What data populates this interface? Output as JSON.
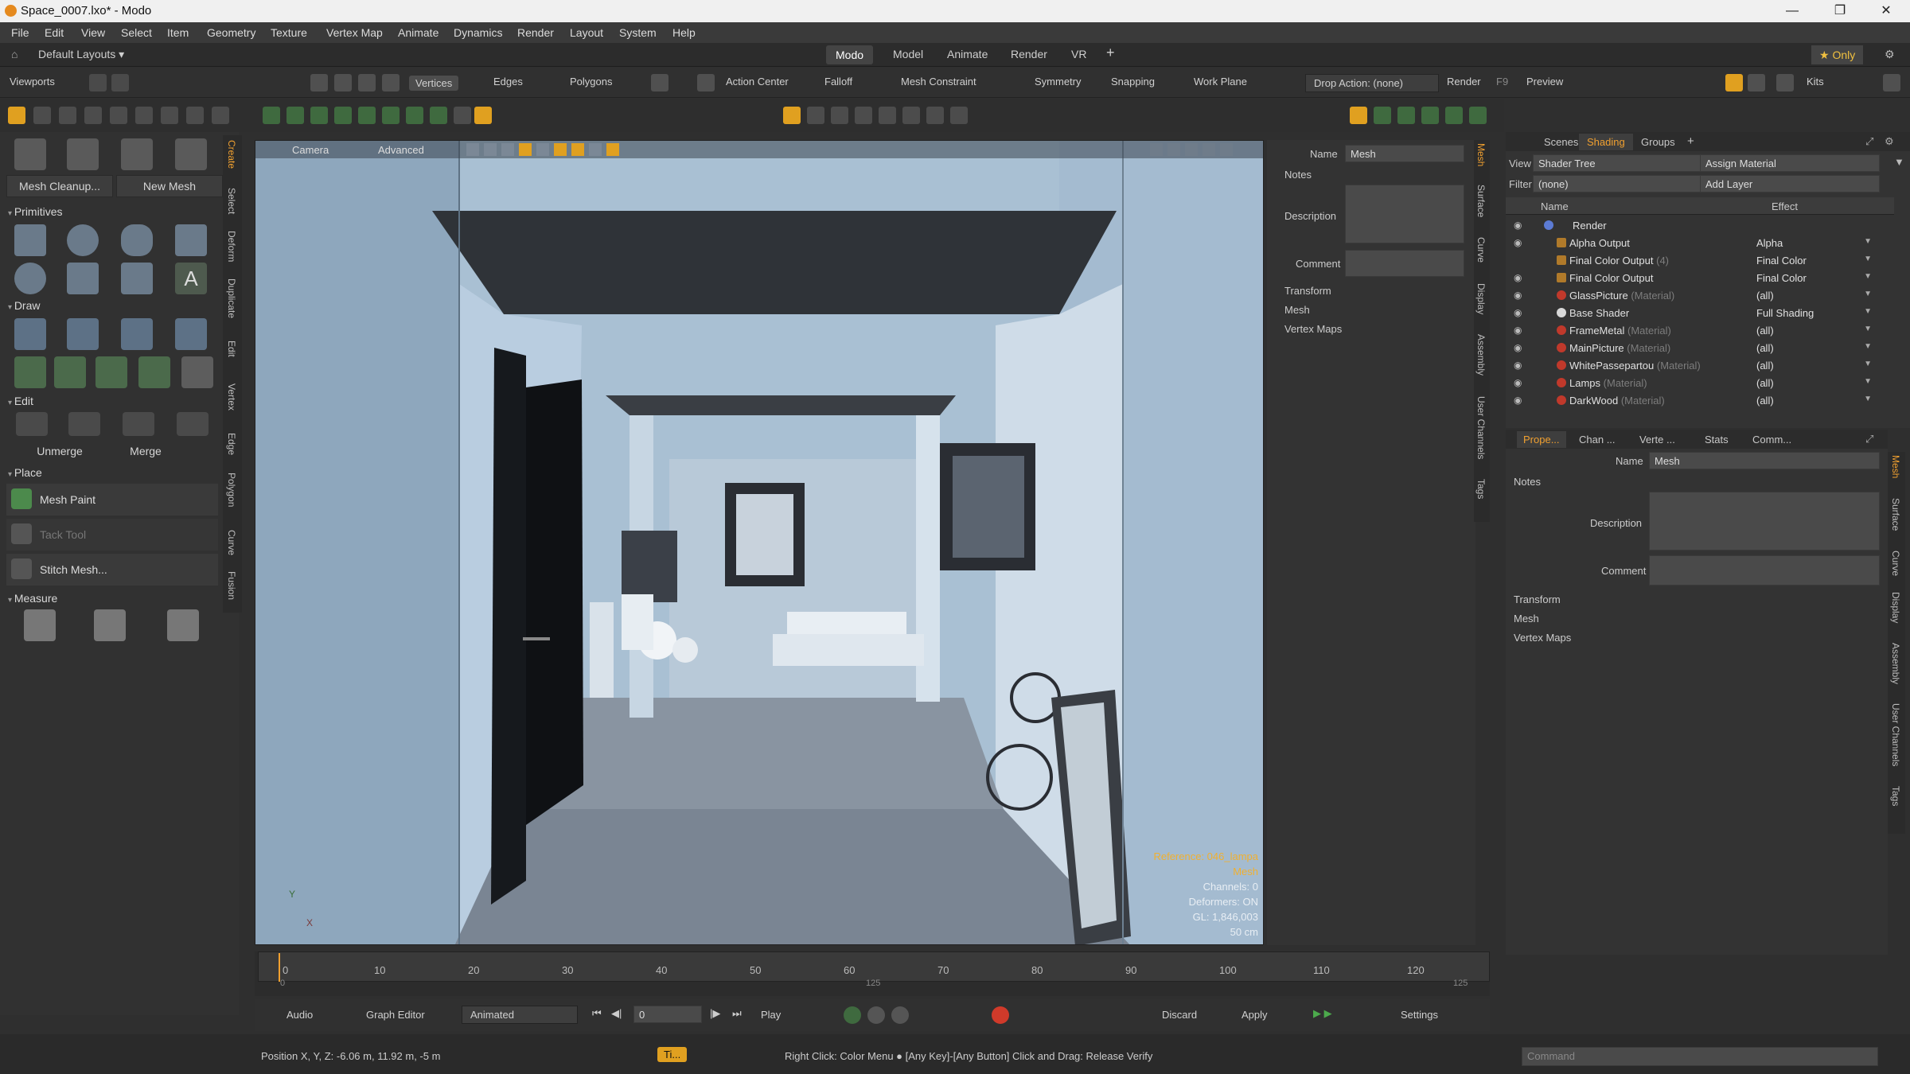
{
  "window": {
    "title": "Space_0007.lxo* - Modo",
    "minimize": "—",
    "maximize": "❐",
    "close": "✕"
  },
  "menu": [
    "File",
    "Edit",
    "View",
    "Select",
    "Item",
    "Geometry",
    "Texture",
    "Vertex Map",
    "Animate",
    "Dynamics",
    "Render",
    "Layout",
    "System",
    "Help"
  ],
  "layout": {
    "preset": "Default Layouts ▾",
    "tabs": [
      "Modo",
      "Model",
      "Animate",
      "Render",
      "VR"
    ],
    "add": "+",
    "only": "★ Only"
  },
  "toolbar": {
    "viewports": "Viewports",
    "vertices": "Vertices",
    "edges": "Edges",
    "polygons": "Polygons",
    "action_center": "Action Center",
    "falloff": "Falloff",
    "mesh_constraint": "Mesh Constraint",
    "symmetry": "Symmetry",
    "snapping": "Snapping",
    "work_plane": "Work Plane",
    "drop_action": "Drop Action: (none)",
    "render": "Render",
    "render_key": "F9",
    "preview": "Preview",
    "kits": "Kits"
  },
  "left": {
    "buttons": {
      "mesh_cleanup": "Mesh Cleanup...",
      "new_mesh": "New Mesh",
      "unmerge": "Unmerge",
      "merge": "Merge"
    },
    "sections": {
      "primitives": "Primitives",
      "draw": "Draw",
      "edit": "Edit",
      "place": "Place",
      "measure": "Measure"
    },
    "place_items": [
      "Mesh Paint",
      "Tack Tool",
      "Stitch Mesh..."
    ],
    "vtabs": [
      "Create",
      "Select",
      "Deform",
      "Duplicate",
      "Edit",
      "Vertex",
      "Edge",
      "Polygon",
      "Curve",
      "Fusion"
    ]
  },
  "viewport": {
    "camera": "Camera",
    "advanced": "Advanced",
    "info": [
      "Reference: 046_lampa",
      "Mesh",
      "Channels: 0",
      "Deformers: ON",
      "GL: 1,846,003",
      "50 cm"
    ],
    "axis_y": "Y",
    "axis_x": "X"
  },
  "mid_props": {
    "name_label": "Name",
    "name_value": "Mesh",
    "notes": "Notes",
    "description": "Description",
    "comment": "Comment",
    "transform": "Transform",
    "mesh": "Mesh",
    "vertex_maps": "Vertex Maps",
    "vtabs": [
      "Mesh",
      "Surface",
      "Curve",
      "Display",
      "Assembly",
      "User Channels",
      "Tags"
    ]
  },
  "shader": {
    "tabs": [
      "Scenes",
      "Shading",
      "Groups",
      "+"
    ],
    "view_label": "View",
    "view_value": "Shader Tree",
    "assign": "Assign Material",
    "filter_label": "Filter",
    "filter_value": "(none)",
    "add_layer": "Add Layer",
    "col_name": "Name",
    "col_effect": "Effect",
    "rows": [
      {
        "name": "Render",
        "tag": "",
        "effect": ""
      },
      {
        "name": "Alpha Output",
        "tag": "",
        "effect": "Alpha"
      },
      {
        "name": "Final Color Output",
        "tag": "(4)",
        "effect": "Final Color"
      },
      {
        "name": "Final Color Output",
        "tag": "",
        "effect": "Final Color"
      },
      {
        "name": "GlassPicture",
        "tag": "(Material)",
        "effect": "(all)"
      },
      {
        "name": "Base Shader",
        "tag": "",
        "effect": "Full Shading"
      },
      {
        "name": "FrameMetal",
        "tag": "(Material)",
        "effect": "(all)"
      },
      {
        "name": "MainPicture",
        "tag": "(Material)",
        "effect": "(all)"
      },
      {
        "name": "WhitePassepartou",
        "tag": "(Material)",
        "effect": "(all)"
      },
      {
        "name": "Lamps",
        "tag": "(Material)",
        "effect": "(all)"
      },
      {
        "name": "DarkWood",
        "tag": "(Material)",
        "effect": "(all)"
      }
    ]
  },
  "props": {
    "tabs": [
      "Prope...",
      "Chan ...",
      "Verte ...",
      "Stats",
      "Comm..."
    ],
    "name_label": "Name",
    "name_value": "Mesh",
    "notes": "Notes",
    "description": "Description",
    "comment": "Comment",
    "transform": "Transform",
    "mesh": "Mesh",
    "vertex_maps": "Vertex Maps",
    "vtabs": [
      "Mesh",
      "Surface",
      "Curve",
      "Display",
      "Assembly",
      "User Channels",
      "Tags"
    ]
  },
  "timeline": {
    "ticks": [
      "0",
      "10",
      "20",
      "30",
      "40",
      "50",
      "60",
      "70",
      "80",
      "90",
      "100",
      "110",
      "120"
    ],
    "sub_ticks": [
      "0",
      "125",
      "125"
    ],
    "audio": "Audio",
    "graph_editor": "Graph Editor",
    "animated": "Animated",
    "frame": "0",
    "play": "Play",
    "discard": "Discard",
    "apply": "Apply",
    "settings": "Settings"
  },
  "status": {
    "position": "Position X, Y, Z:  -6.06 m, 11.92 m, -5 m",
    "hint": "Right Click: Color Menu ● [Any Key]-[Any Button] Click and Drag: Release Verify",
    "command": "Command",
    "ti": "Ti..."
  },
  "colors": {
    "accent": "#e8a020",
    "viewport_bg": "#98aec2",
    "sky": "#a9bfd3",
    "dark": "#1b1f24"
  }
}
